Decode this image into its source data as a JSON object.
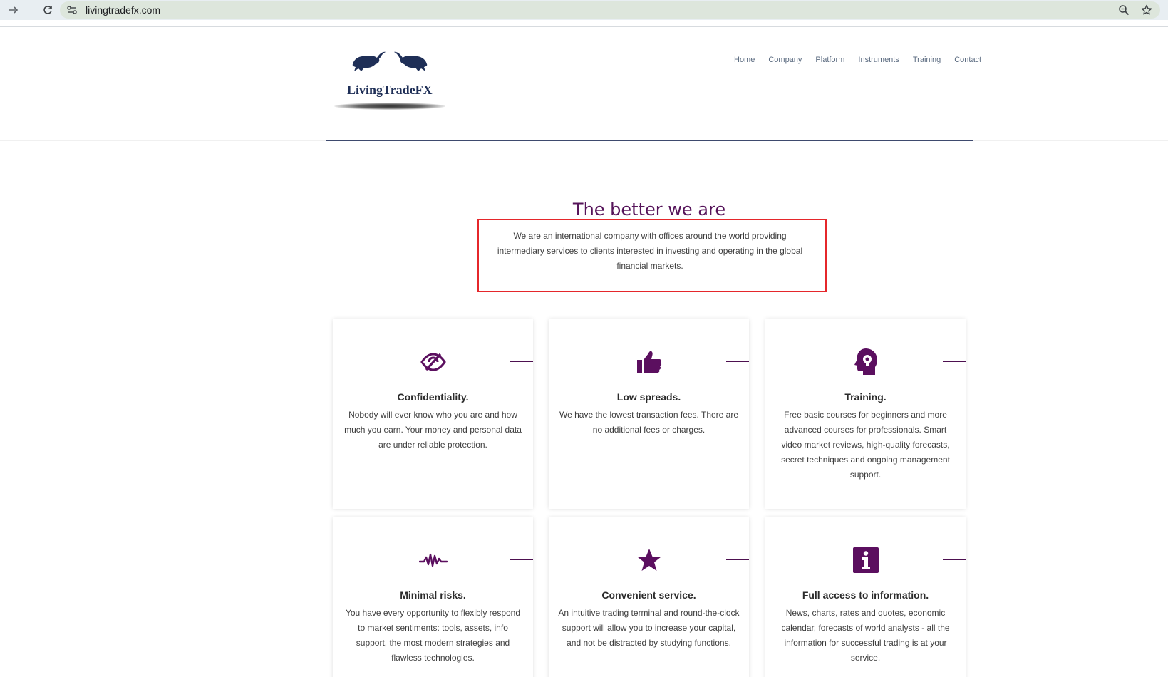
{
  "browser": {
    "url": "livingtradefx.com"
  },
  "logo": {
    "text": "LivingTradeFX"
  },
  "nav": {
    "items": [
      "Home",
      "Company",
      "Platform",
      "Instruments",
      "Training",
      "Contact"
    ]
  },
  "section": {
    "title": "The better we are",
    "intro": "We are an international company with offices around the world providing intermediary services to clients interested in investing and operating in the global financial markets."
  },
  "cards": [
    {
      "icon": "eye-slash-icon",
      "title": "Confidentiality.",
      "text": "Nobody will ever know who you are and how much you earn. Your money and personal data are under reliable protection."
    },
    {
      "icon": "thumbs-up-icon",
      "title": "Low spreads.",
      "text": "We have the lowest transaction fees. There are no additional fees or charges."
    },
    {
      "icon": "head-lightbulb-icon",
      "title": "Training.",
      "text": "Free basic courses for beginners and more advanced courses for professionals. Smart video market reviews, high-quality forecasts, secret techniques and ongoing management support."
    },
    {
      "icon": "wave-icon",
      "title": "Minimal risks.",
      "text": "You have every opportunity to flexibly respond to market sentiments: tools, assets, info support, the most modern strategies and flawless technologies."
    },
    {
      "icon": "star-icon",
      "title": "Convenient service.",
      "text": "An intuitive trading terminal and round-the-clock support will allow you to increase your capital, and not be distracted by studying functions."
    },
    {
      "icon": "info-icon",
      "title": "Full access to information.",
      "text": "News, charts, rates and quotes, economic calendar, forecasts of world analysts - all the information for successful trading is at your service."
    }
  ],
  "colors": {
    "accent": "#5b0f5f",
    "highlight_border": "#e5272b",
    "rule": "#3e4a6e"
  }
}
